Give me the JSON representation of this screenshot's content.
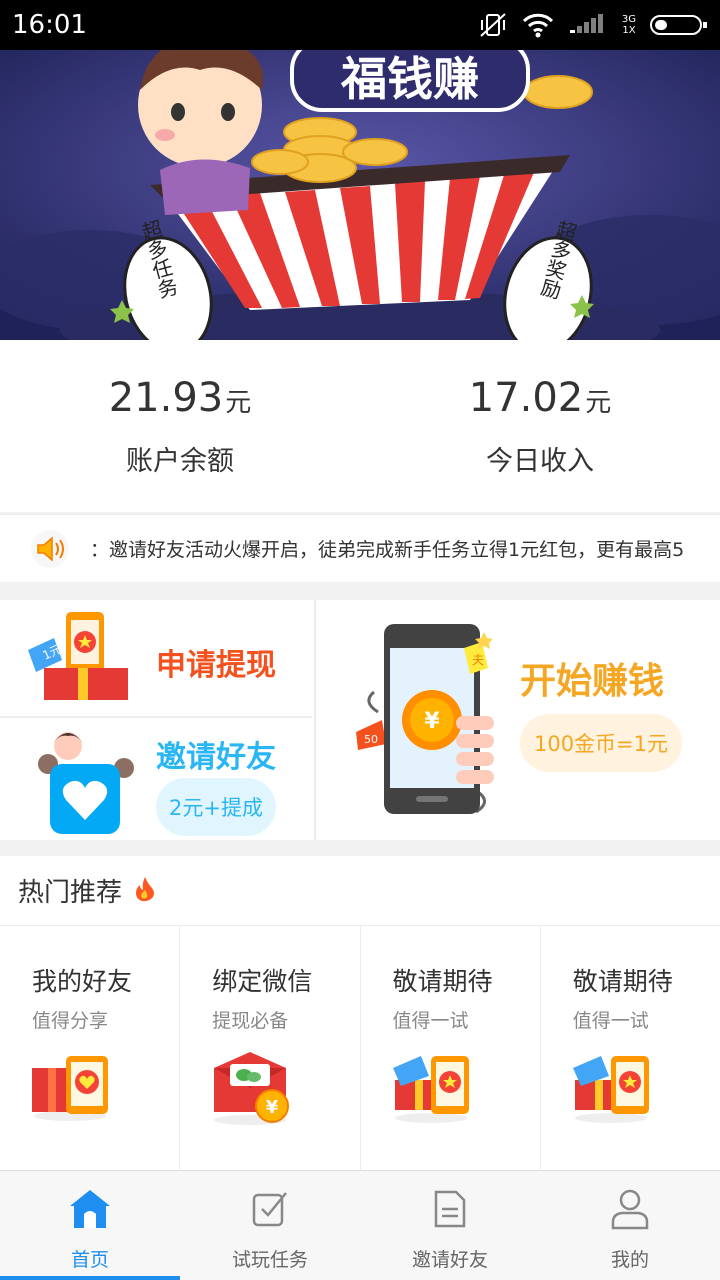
{
  "status_bar": {
    "time": "16:01",
    "network_top": "3G",
    "network_bottom": "1X"
  },
  "banner": {
    "title": "福钱赚",
    "left_bubble": "超多任务",
    "right_bubble": "超多奖励"
  },
  "stats": {
    "balance_value": "21.93",
    "balance_unit": "元",
    "balance_label": "账户余额",
    "income_value": "17.02",
    "income_unit": "元",
    "income_label": "今日收入"
  },
  "notice": {
    "text": "：邀请好友活动火爆开启，徒弟完成新手任务立得1元红包，更有最高5"
  },
  "actions": {
    "withdraw_label": "申请提现",
    "invite_label": "邀请好友",
    "invite_pill": "2元+提成",
    "earn_label": "开始赚钱",
    "earn_pill": "100金币=1元",
    "badge_1": "1元",
    "badge_50": "50",
    "badge_fu": "夫"
  },
  "hot": {
    "title": "热门推荐",
    "cards": [
      {
        "title": "我的好友",
        "subtitle": "值得分享"
      },
      {
        "title": "绑定微信",
        "subtitle": "提现必备"
      },
      {
        "title": "敬请期待",
        "subtitle": "值得一试"
      },
      {
        "title": "敬请期待",
        "subtitle": "值得一试"
      }
    ]
  },
  "nav": {
    "items": [
      {
        "label": "首页",
        "icon": "home-icon"
      },
      {
        "label": "试玩任务",
        "icon": "task-icon"
      },
      {
        "label": "邀请好友",
        "icon": "document-icon"
      },
      {
        "label": "我的",
        "icon": "user-icon"
      }
    ],
    "active_color": "#1e8ff0"
  },
  "colors": {
    "withdraw": "#f4511e",
    "invite": "#29b6f6",
    "earn": "#f5a623",
    "pill_bg_invite": "#e1f5fe",
    "pill_bg_earn": "#fff3e0"
  }
}
